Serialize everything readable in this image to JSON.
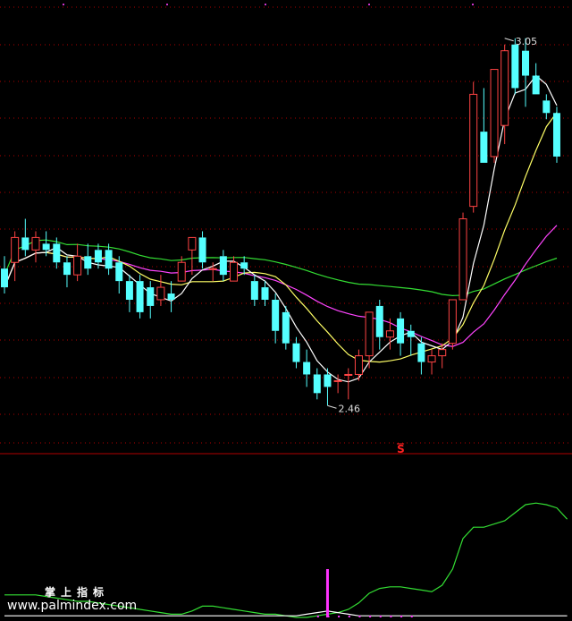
{
  "watermark": {
    "line1": "掌上指标",
    "line2": "www.palmindex.com"
  },
  "chart_data": [
    {
      "type": "candlestick",
      "panel": "price",
      "ylim": [
        2.4,
        3.1
      ],
      "grid": true,
      "colors": {
        "up": "#ff4444",
        "down": "#55ffff",
        "ma5": "#ffffff",
        "ma10": "#ffff66",
        "ma20": "#ff44ff",
        "ma60": "#33dd33",
        "grid": "#b00000"
      },
      "annotations": [
        {
          "text": "2.46",
          "index": 31,
          "value": 2.46
        },
        {
          "text": "3.05",
          "index": 48,
          "value": 3.05
        }
      ],
      "signal": {
        "text": "S",
        "index": 38
      },
      "candles": [
        [
          2.68,
          2.7,
          2.64,
          2.65
        ],
        [
          2.69,
          2.74,
          2.66,
          2.73
        ],
        [
          2.73,
          2.76,
          2.7,
          2.71
        ],
        [
          2.71,
          2.74,
          2.69,
          2.73
        ],
        [
          2.72,
          2.74,
          2.7,
          2.71
        ],
        [
          2.72,
          2.73,
          2.68,
          2.69
        ],
        [
          2.69,
          2.7,
          2.65,
          2.67
        ],
        [
          2.67,
          2.72,
          2.66,
          2.7
        ],
        [
          2.7,
          2.72,
          2.67,
          2.68
        ],
        [
          2.71,
          2.72,
          2.68,
          2.69
        ],
        [
          2.71,
          2.72,
          2.67,
          2.68
        ],
        [
          2.69,
          2.7,
          2.64,
          2.66
        ],
        [
          2.66,
          2.67,
          2.61,
          2.63
        ],
        [
          2.66,
          2.67,
          2.6,
          2.61
        ],
        [
          2.65,
          2.66,
          2.6,
          2.62
        ],
        [
          2.63,
          2.67,
          2.62,
          2.65
        ],
        [
          2.64,
          2.66,
          2.61,
          2.63
        ],
        [
          2.66,
          2.7,
          2.66,
          2.69
        ],
        [
          2.71,
          2.73,
          2.67,
          2.73
        ],
        [
          2.73,
          2.74,
          2.68,
          2.69
        ],
        [
          2.68,
          2.69,
          2.66,
          2.68
        ],
        [
          2.7,
          2.71,
          2.66,
          2.67
        ],
        [
          2.66,
          2.7,
          2.66,
          2.69
        ],
        [
          2.69,
          2.7,
          2.67,
          2.68
        ],
        [
          2.66,
          2.67,
          2.62,
          2.63
        ],
        [
          2.65,
          2.66,
          2.62,
          2.63
        ],
        [
          2.63,
          2.64,
          2.56,
          2.58
        ],
        [
          2.61,
          2.62,
          2.55,
          2.56
        ],
        [
          2.56,
          2.57,
          2.52,
          2.53
        ],
        [
          2.53,
          2.55,
          2.49,
          2.51
        ],
        [
          2.51,
          2.52,
          2.47,
          2.48
        ],
        [
          2.51,
          2.52,
          2.46,
          2.49
        ],
        [
          2.5,
          2.51,
          2.48,
          2.5
        ],
        [
          2.51,
          2.52,
          2.47,
          2.51
        ],
        [
          2.51,
          2.55,
          2.5,
          2.54
        ],
        [
          2.54,
          2.61,
          2.52,
          2.61
        ],
        [
          2.62,
          2.63,
          2.55,
          2.57
        ],
        [
          2.57,
          2.6,
          2.55,
          2.58
        ],
        [
          2.6,
          2.61,
          2.54,
          2.56
        ],
        [
          2.58,
          2.59,
          2.54,
          2.57
        ],
        [
          2.56,
          2.57,
          2.51,
          2.53
        ],
        [
          2.53,
          2.55,
          2.51,
          2.54
        ],
        [
          2.54,
          2.56,
          2.52,
          2.55
        ],
        [
          2.56,
          2.63,
          2.55,
          2.63
        ],
        [
          2.63,
          2.77,
          2.63,
          2.76
        ],
        [
          2.78,
          2.98,
          2.77,
          2.96
        ],
        [
          2.9,
          2.97,
          2.85,
          2.85
        ],
        [
          2.86,
          3.0,
          2.85,
          3.0
        ],
        [
          2.91,
          3.04,
          2.88,
          3.03
        ],
        [
          3.04,
          3.05,
          2.96,
          2.97
        ],
        [
          3.03,
          3.05,
          2.94,
          2.99
        ],
        [
          2.99,
          3.01,
          2.96,
          2.96
        ],
        [
          2.95,
          2.96,
          2.92,
          2.93
        ],
        [
          2.93,
          2.94,
          2.85,
          2.86
        ]
      ]
    },
    {
      "type": "line",
      "panel": "indicator",
      "ylim": [
        0,
        100
      ],
      "series": [
        {
          "color": "#33dd33",
          "values": [
            14,
            14,
            14,
            14,
            13,
            12,
            11,
            10,
            10,
            9,
            8,
            7,
            6,
            5,
            4,
            3,
            2,
            2,
            4,
            7,
            7,
            6,
            5,
            4,
            3,
            2,
            2,
            1,
            0,
            0,
            1,
            2,
            3,
            5,
            9,
            15,
            18,
            19,
            19,
            18,
            17,
            16,
            20,
            30,
            49,
            56,
            56,
            58,
            60,
            65,
            70,
            71,
            70,
            68,
            61
          ]
        },
        {
          "color": "#ffffff",
          "values": [
            1,
            1,
            1,
            1,
            1,
            1,
            1,
            1,
            1,
            1,
            1,
            1,
            1,
            1,
            1,
            1,
            1,
            1,
            1,
            1,
            1,
            1,
            1,
            1,
            1,
            1,
            1,
            1,
            1,
            2,
            3,
            4,
            3,
            2,
            1,
            1,
            1,
            1,
            1,
            1,
            1,
            1,
            1,
            1,
            1,
            1,
            1,
            1,
            1,
            1,
            1,
            1,
            1,
            1,
            1
          ]
        }
      ],
      "events": [
        {
          "index": 31,
          "value": 30
        }
      ]
    }
  ]
}
